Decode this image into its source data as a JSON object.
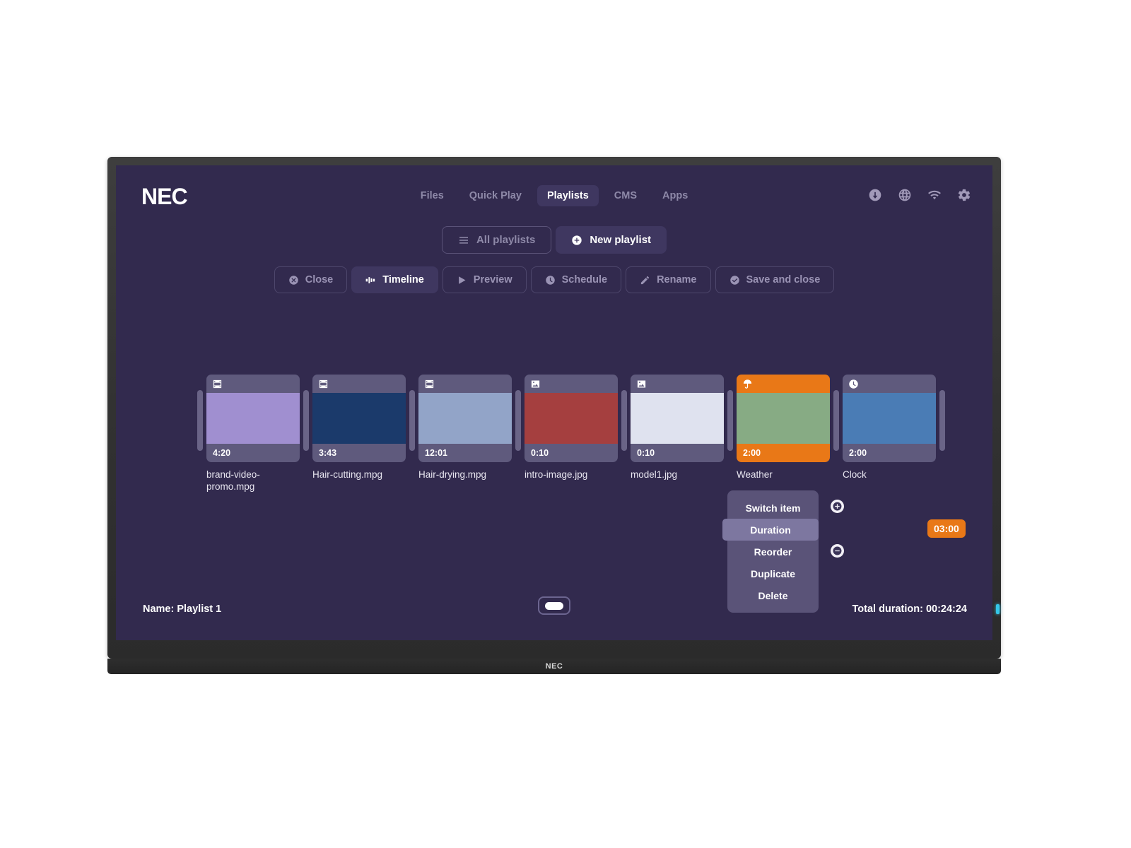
{
  "header": {
    "brand": "NEC",
    "nav": [
      {
        "label": "Files",
        "active": false
      },
      {
        "label": "Quick Play",
        "active": false
      },
      {
        "label": "Playlists",
        "active": true
      },
      {
        "label": "CMS",
        "active": false
      },
      {
        "label": "Apps",
        "active": false
      }
    ],
    "icons": [
      "download-icon",
      "globe-icon",
      "wifi-icon",
      "gear-icon"
    ]
  },
  "playlist_bar": {
    "all_playlists_label": "All playlists",
    "new_playlist_label": "New playlist"
  },
  "toolbar": {
    "buttons": [
      {
        "label": "Close",
        "icon": "close-circle-icon",
        "active": false
      },
      {
        "label": "Timeline",
        "icon": "timeline-icon",
        "active": true
      },
      {
        "label": "Preview",
        "icon": "play-icon",
        "active": false
      },
      {
        "label": "Schedule",
        "icon": "clock-icon",
        "active": false
      },
      {
        "label": "Rename",
        "icon": "pencil-icon",
        "active": false
      },
      {
        "label": "Save and close",
        "icon": "check-circle-icon",
        "active": false
      }
    ]
  },
  "timeline": {
    "items": [
      {
        "name": "brand-video-promo.mpg",
        "duration": "4:20",
        "icon": "film-icon",
        "thumb_color": "#a08fd0",
        "selected": false
      },
      {
        "name": "Hair-cutting.mpg",
        "duration": "3:43",
        "icon": "film-icon",
        "thumb_color": "#1b3a6b",
        "selected": false
      },
      {
        "name": "Hair-drying.mpg",
        "duration": "12:01",
        "icon": "film-icon",
        "thumb_color": "#92a4c8",
        "selected": false
      },
      {
        "name": "intro-image.jpg",
        "duration": "0:10",
        "icon": "image-icon",
        "thumb_color": "#a53f3f",
        "selected": false
      },
      {
        "name": "model1.jpg",
        "duration": "0:10",
        "icon": "image-icon",
        "thumb_color": "#dfe2ef",
        "selected": false
      },
      {
        "name": "Weather",
        "duration": "2:00",
        "icon": "umbrella-icon",
        "thumb_color": "#87ab84",
        "selected": true
      },
      {
        "name": "Clock",
        "duration": "2:00",
        "icon": "clock-icon",
        "thumb_color": "#4a7cb5",
        "selected": false
      }
    ]
  },
  "context_menu": {
    "items": [
      {
        "label": "Switch item",
        "highlight": false
      },
      {
        "label": "Duration",
        "highlight": true
      },
      {
        "label": "Reorder",
        "highlight": false
      },
      {
        "label": "Duplicate",
        "highlight": false
      },
      {
        "label": "Delete",
        "highlight": false
      }
    ],
    "duration_value": "03:00",
    "increase_label": "+",
    "decrease_label": "-"
  },
  "footer": {
    "playlist_name": "Name: Playlist 1",
    "total_duration": "Total duration: 00:24:24"
  },
  "device": {
    "bezel_logo": "NEC"
  },
  "colors": {
    "background": "#322a4e",
    "accent": "#e97817",
    "card": "#5f5a7d",
    "active_nav": "#3f3760"
  }
}
